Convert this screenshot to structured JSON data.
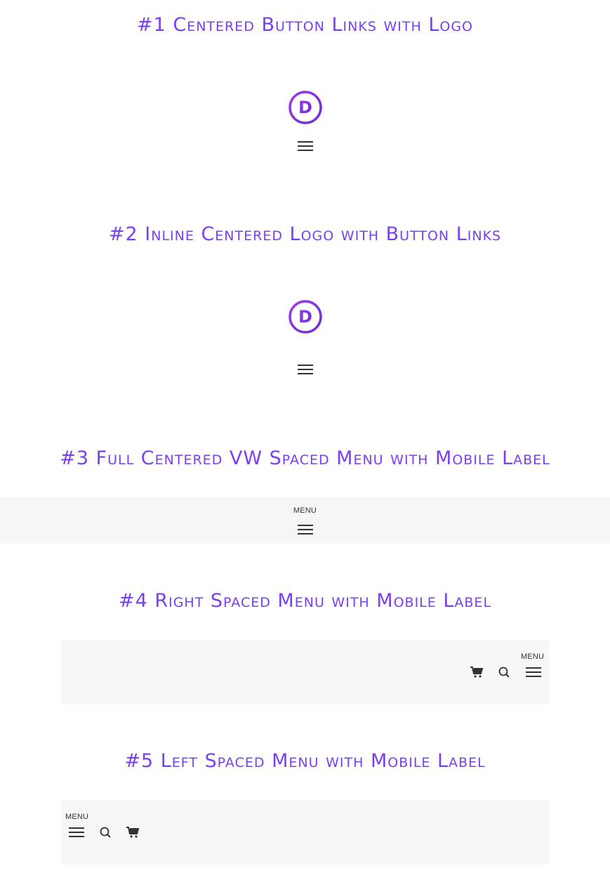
{
  "colors": {
    "accent": "#7a3ff0",
    "bar_bg": "#f7f7f7",
    "icon": "#333333"
  },
  "sections": [
    {
      "title": "#1 Centered Button Links with Logo"
    },
    {
      "title": "#2 Inline Centered Logo with Button Links"
    },
    {
      "title": "#3 Full Centered VW Spaced Menu with Mobile Label",
      "menu_label": "MENU"
    },
    {
      "title": "#4 Right Spaced Menu with Mobile Label",
      "menu_label": "MENU"
    },
    {
      "title": "#5 Left Spaced Menu with Mobile Label",
      "menu_label": "MENU"
    }
  ],
  "logo": {
    "letter": "D",
    "icon": "divi-logo-icon"
  },
  "icons": {
    "hamburger": "hamburger-menu-icon",
    "search": "search-icon",
    "cart": "shopping-cart-icon"
  }
}
